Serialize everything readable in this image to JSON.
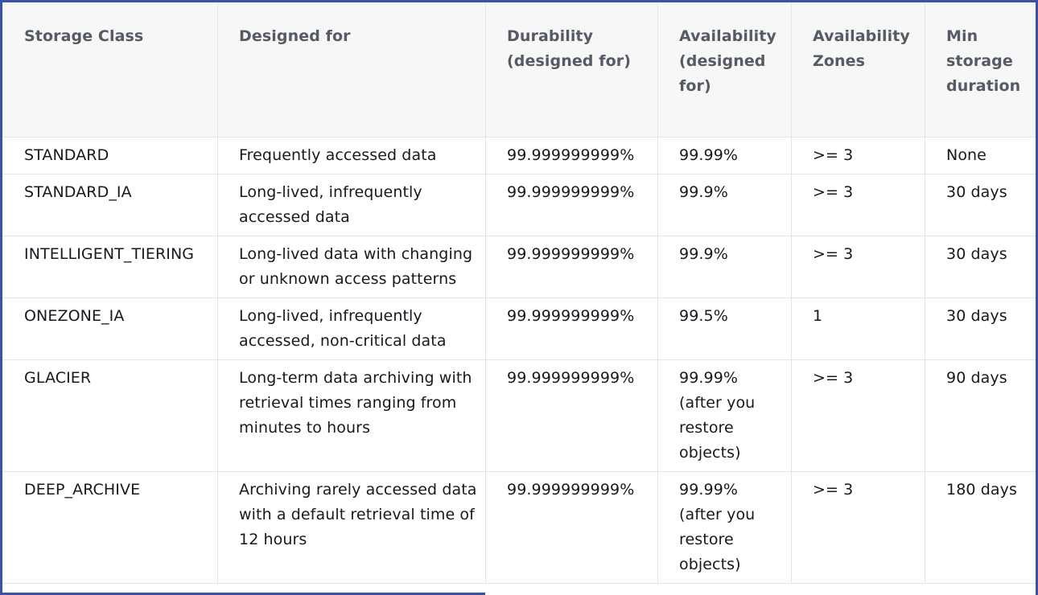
{
  "table": {
    "headers": [
      "Storage Class",
      "Designed for",
      "Durability (designed for)",
      "Availability (designed for)",
      "Availability Zones",
      "Min storage duration"
    ],
    "rows": [
      [
        "STANDARD",
        "Frequently accessed data",
        "99.999999999%",
        "99.99%",
        ">= 3",
        "None"
      ],
      [
        "STANDARD_IA",
        "Long-lived, infrequently accessed data",
        "99.999999999%",
        "99.9%",
        ">= 3",
        "30 days"
      ],
      [
        "INTELLIGENT_TIERING",
        "Long-lived data with changing or unknown access patterns",
        "99.999999999%",
        "99.9%",
        ">= 3",
        "30 days"
      ],
      [
        "ONEZONE_IA",
        "Long-lived, infrequently accessed, non-critical data",
        "99.999999999%",
        "99.5%",
        "1",
        "30 days"
      ],
      [
        "GLACIER",
        "Long-term data archiving with retrieval times ranging from minutes to hours",
        "99.999999999%",
        "99.99% (after you restore objects)",
        ">= 3",
        "90 days"
      ],
      [
        "DEEP_ARCHIVE",
        "Archiving rarely accessed data with a default retrieval time of 12 hours",
        "99.999999999%",
        "99.99% (after you restore objects)",
        ">= 3",
        "180 days"
      ]
    ]
  },
  "colors": {
    "frame_border": "#3a4fb0",
    "header_background": "#f7f7f7",
    "header_text": "#545b64",
    "body_text": "#16191f",
    "grid_line": "#e2e4e6"
  }
}
